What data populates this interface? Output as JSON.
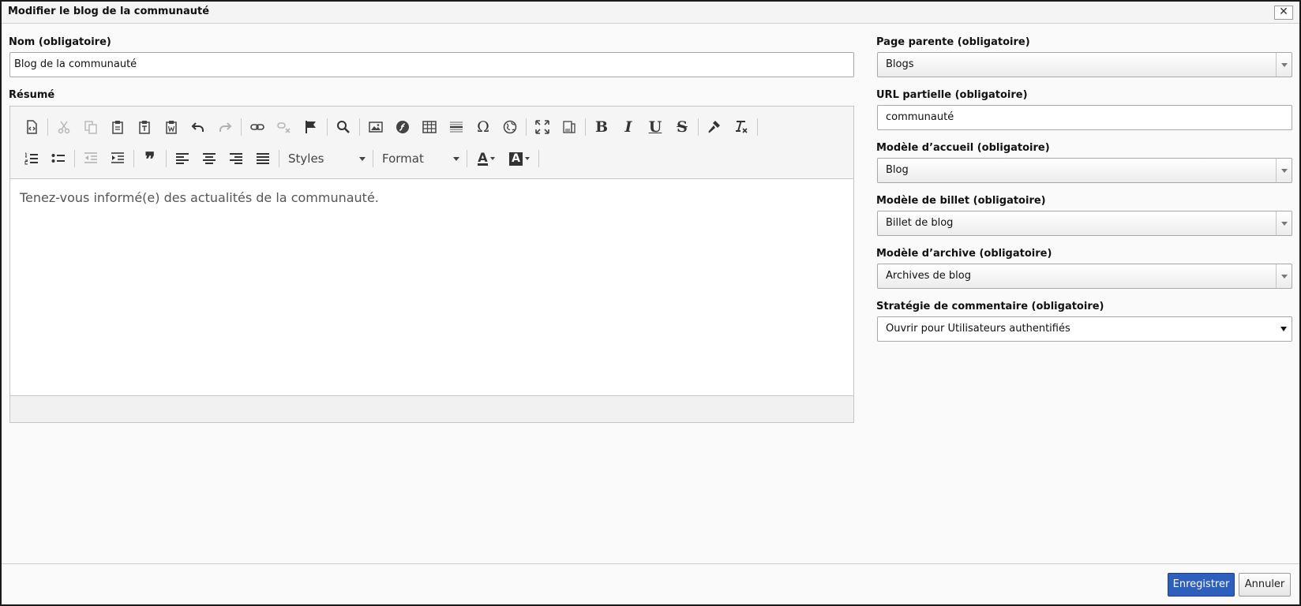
{
  "dialog": {
    "title": "Modifier le blog de la communauté",
    "close_label": "✕"
  },
  "form": {
    "name": {
      "label": "Nom (obligatoire)",
      "value": "Blog de la communauté"
    },
    "summary": {
      "label": "Résumé",
      "content": "Tenez-vous informé(e) des actualités de la communauté."
    },
    "parent_page": {
      "label": "Page parente (obligatoire)",
      "value": "Blogs"
    },
    "partial_url": {
      "label": "URL partielle (obligatoire)",
      "value": "communauté"
    },
    "home_template": {
      "label": "Modèle d’accueil (obligatoire)",
      "value": "Blog"
    },
    "post_template": {
      "label": "Modèle de billet (obligatoire)",
      "value": "Billet de blog"
    },
    "archive_template": {
      "label": "Modèle d’archive (obligatoire)",
      "value": "Archives de blog"
    },
    "comment_strategy": {
      "label": "Stratégie de commentaire (obligatoire)",
      "value": "Ouvrir pour Utilisateurs authentifiés"
    }
  },
  "toolbar": {
    "styles_label": "Styles",
    "format_label": "Format",
    "text_color_glyph": "A",
    "bg_color_glyph": "A",
    "omega_glyph": "Ω",
    "bold_glyph": "B",
    "italic_glyph": "I",
    "underline_glyph": "U",
    "strike_glyph": "S",
    "quote_glyph": "❞"
  },
  "buttons": {
    "save": "Enregistrer",
    "cancel": "Annuler"
  },
  "colors": {
    "primary": "#2e5fbc",
    "border": "#a8a8a8",
    "toolbar_bg": "#f5f5f5"
  }
}
